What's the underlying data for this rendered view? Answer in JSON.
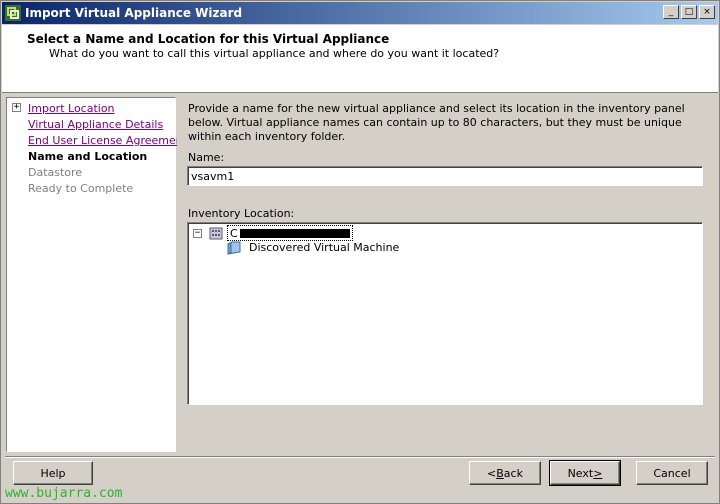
{
  "window": {
    "title": "Import Virtual Appliance Wizard",
    "controls": [
      "_",
      "□",
      "×"
    ]
  },
  "header": {
    "title": "Select a Name and Location for this Virtual Appliance",
    "subtitle": "What do you want to call this virtual appliance and where do you want it located?"
  },
  "steps": [
    {
      "label": "Import Location",
      "state": "link"
    },
    {
      "label": "Virtual Appliance Details",
      "state": "link"
    },
    {
      "label": "End User License Agreement",
      "state": "link"
    },
    {
      "label": "Name and Location",
      "state": "current"
    },
    {
      "label": "Datastore",
      "state": "disabled"
    },
    {
      "label": "Ready to Complete",
      "state": "disabled"
    }
  ],
  "main": {
    "description": "Provide a name for the new virtual appliance and select its location in the inventory panel below. Virtual appliance names can contain up to 80 characters, but they must be unique within each inventory folder.",
    "name_label": "Name:",
    "name_value": "vsavm1",
    "inventory_label": "Inventory Location:",
    "tree": {
      "root_prefix": "C",
      "child": "Discovered Virtual Machine"
    }
  },
  "buttons": {
    "help": "Help",
    "back_ul": "B",
    "back_rest": "ack",
    "back_prefix": "< ",
    "next_prefix": "Next ",
    "next_ul": ">",
    "cancel": "Cancel"
  },
  "watermark": "www.bujarra.com",
  "colors": {
    "titlebar_start": "#0a246a",
    "titlebar_end": "#a6caf0",
    "link": "#800080",
    "watermark": "#2bb52b"
  }
}
